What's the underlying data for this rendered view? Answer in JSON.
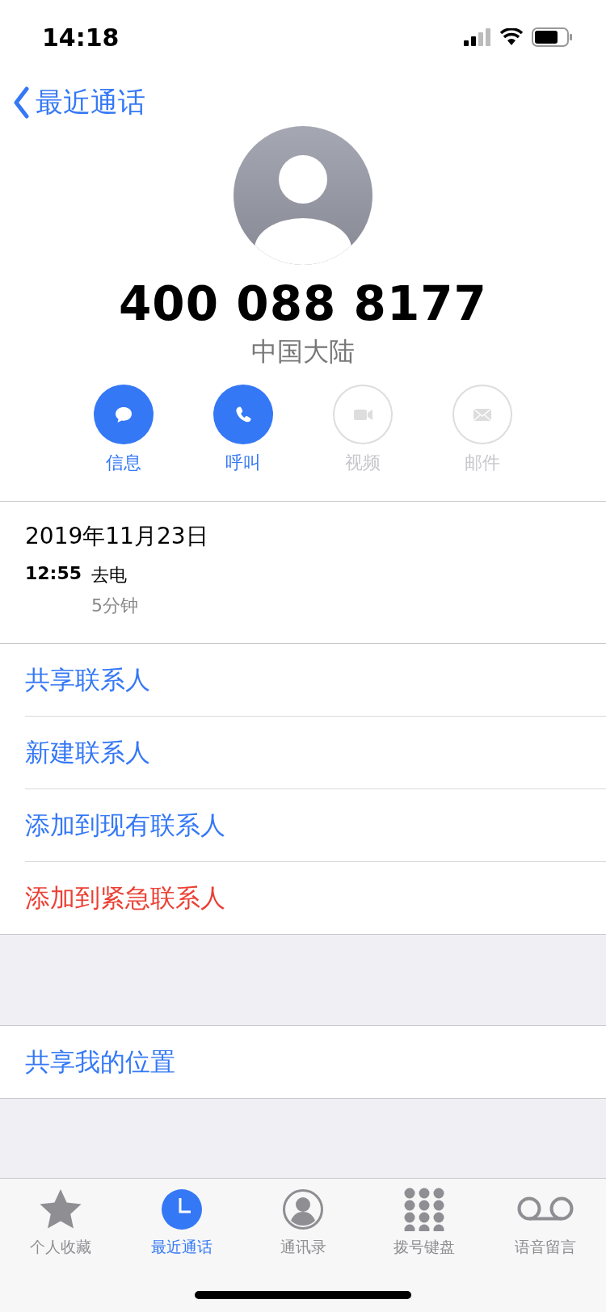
{
  "status_bar": {
    "time": "14:18"
  },
  "nav": {
    "back": "最近通话"
  },
  "contact": {
    "number": "400 088 8177",
    "region": "中国大陆"
  },
  "actions": [
    {
      "kind": "message",
      "label": "信息",
      "disabled": false
    },
    {
      "kind": "call",
      "label": "呼叫",
      "disabled": false
    },
    {
      "kind": "video",
      "label": "视频",
      "disabled": true
    },
    {
      "kind": "mail",
      "label": "邮件",
      "disabled": true
    }
  ],
  "call_log": {
    "date": "2019年11月23日",
    "calls": [
      {
        "time": "12:55",
        "type": "去电",
        "duration": "5分钟"
      }
    ]
  },
  "options": [
    {
      "label": "共享联系人",
      "kind": "normal"
    },
    {
      "label": "新建联系人",
      "kind": "normal"
    },
    {
      "label": "添加到现有联系人",
      "kind": "normal"
    },
    {
      "label": "添加到紧急联系人",
      "kind": "destructive"
    }
  ],
  "location": {
    "label": "共享我的位置"
  },
  "tabs": [
    {
      "kind": "favorites",
      "label": "个人收藏",
      "selected": false
    },
    {
      "kind": "recents",
      "label": "最近通话",
      "selected": true
    },
    {
      "kind": "contacts",
      "label": "通讯录",
      "selected": false
    },
    {
      "kind": "keypad",
      "label": "拨号键盘",
      "selected": false
    },
    {
      "kind": "voicemail",
      "label": "语音留言",
      "selected": false
    }
  ]
}
